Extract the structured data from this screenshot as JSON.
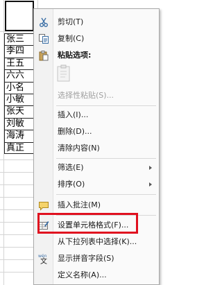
{
  "sheet": {
    "names": [
      "张三",
      "李四",
      "王五",
      "六六",
      "小名",
      "小敏",
      "张天",
      "刘敏",
      "海涛",
      "真正"
    ]
  },
  "menu": {
    "cut": "剪切(T)",
    "copy": "复制(C)",
    "paste_options": "粘贴选项:",
    "paste_special": "选择性粘贴(S)...",
    "insert": "插入(I)...",
    "delete": "删除(D)...",
    "clear_contents": "清除内容(N)",
    "filter": "筛选(E)",
    "sort": "排序(O)",
    "insert_comment": "插入批注(M)",
    "format_cells": "设置单元格格式(F)...",
    "pick_from_list": "从下拉列表中选择(K)...",
    "show_phonetic": "显示拼音字段(S)",
    "define_name": "定义名称(A)..."
  },
  "highlight_color": "#e0101f"
}
